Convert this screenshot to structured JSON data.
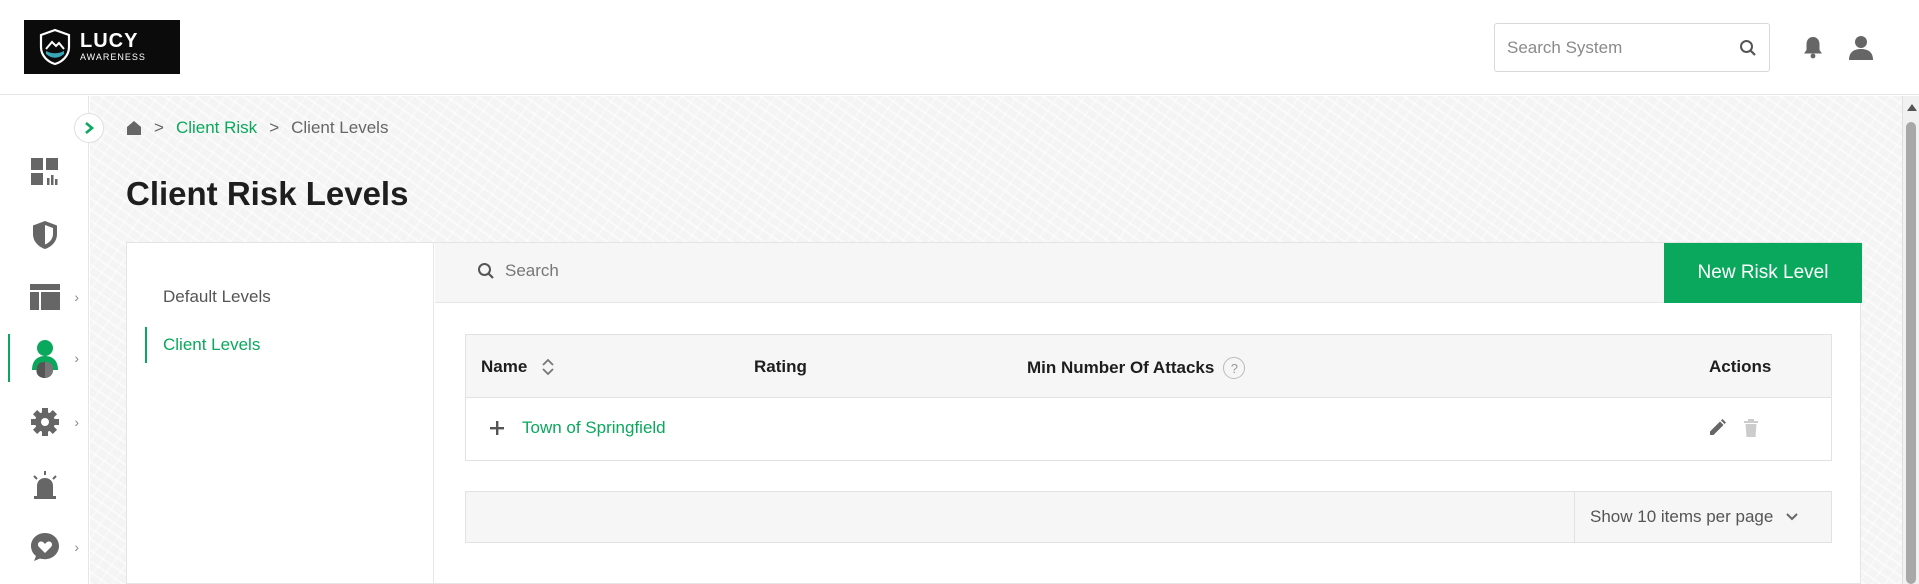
{
  "app": {
    "brand": "LUCY",
    "brand_sub": "AWARENESS"
  },
  "header": {
    "search_placeholder": "Search System",
    "icons": [
      "search-icon",
      "bell-icon",
      "user-icon"
    ]
  },
  "rail": {
    "items": [
      {
        "name": "dashboard",
        "icon": "dashboard-icon",
        "has_children": false
      },
      {
        "name": "security",
        "icon": "shield-icon",
        "has_children": false
      },
      {
        "name": "campaigns",
        "icon": "layout-icon",
        "has_children": true
      },
      {
        "name": "clients",
        "icon": "client-icon",
        "has_children": true,
        "active": true
      },
      {
        "name": "settings",
        "icon": "gear-icon",
        "has_children": true
      },
      {
        "name": "alerts",
        "icon": "siren-icon",
        "has_children": false
      },
      {
        "name": "support",
        "icon": "heart-chat-icon",
        "has_children": true
      }
    ]
  },
  "breadcrumb": {
    "parent": "Client Risk",
    "current": "Client Levels",
    "separator": ">"
  },
  "page": {
    "title": "Client Risk Levels"
  },
  "subnav": {
    "items": [
      "Default Levels",
      "Client Levels"
    ],
    "active_index": 1
  },
  "toolbar": {
    "search_placeholder": "Search",
    "new_button_label": "New Risk Level"
  },
  "table": {
    "columns": {
      "name": "Name",
      "rating": "Rating",
      "min_attacks": "Min Number Of Attacks",
      "help": "?",
      "actions": "Actions"
    },
    "rows": [
      {
        "name": "Town of Springfield",
        "rating": "",
        "min_attacks": ""
      }
    ]
  },
  "pager": {
    "per_page_label": "Show 10 items per page"
  },
  "colors": {
    "accent": "#0aa85c",
    "logo_bg": "#0b0b0b"
  }
}
